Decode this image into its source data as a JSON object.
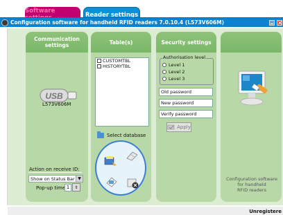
{
  "tabs": {
    "software": "Software settings",
    "reader": "Reader settings"
  },
  "window": {
    "title": "Configuration software for handheld RFID readers 7.0.10.4 (L573V606M)"
  },
  "comm": {
    "header_line1": "Communication",
    "header_line2": "settings",
    "device_label": "L573V606M",
    "action_label": "Action on receive ID:",
    "action_value": "Show on Status Bar",
    "popup_label": "Pop-up time:",
    "popup_value": "1"
  },
  "tables": {
    "header": "Table(s)",
    "items": [
      "CUSTOMTBL",
      "HISTORYTBL"
    ],
    "select_db": "Select database"
  },
  "security": {
    "header": "Security settings",
    "auth_label": "Authorisation level",
    "levels": [
      "Level 1",
      "Level 2",
      "Level 3"
    ],
    "old_password": "Old password",
    "new_password": "New password",
    "verify_password": "Verify password",
    "apply": "Apply"
  },
  "logo_panel": {
    "desc_line1": "Configuration software",
    "desc_line2": "for handheld",
    "desc_line3": "RFID readers"
  },
  "status": {
    "text": "Unregistere"
  },
  "colors": {
    "titlebar": "#0d83cf",
    "active_tab": "#c00070",
    "panel": "#b9d8a8",
    "panel_header": "#7ab868"
  },
  "icons": [
    "app-icon",
    "minimize-icon",
    "close-icon",
    "usb-icon",
    "folder-icon",
    "monitor-icon",
    "apply-icon"
  ]
}
